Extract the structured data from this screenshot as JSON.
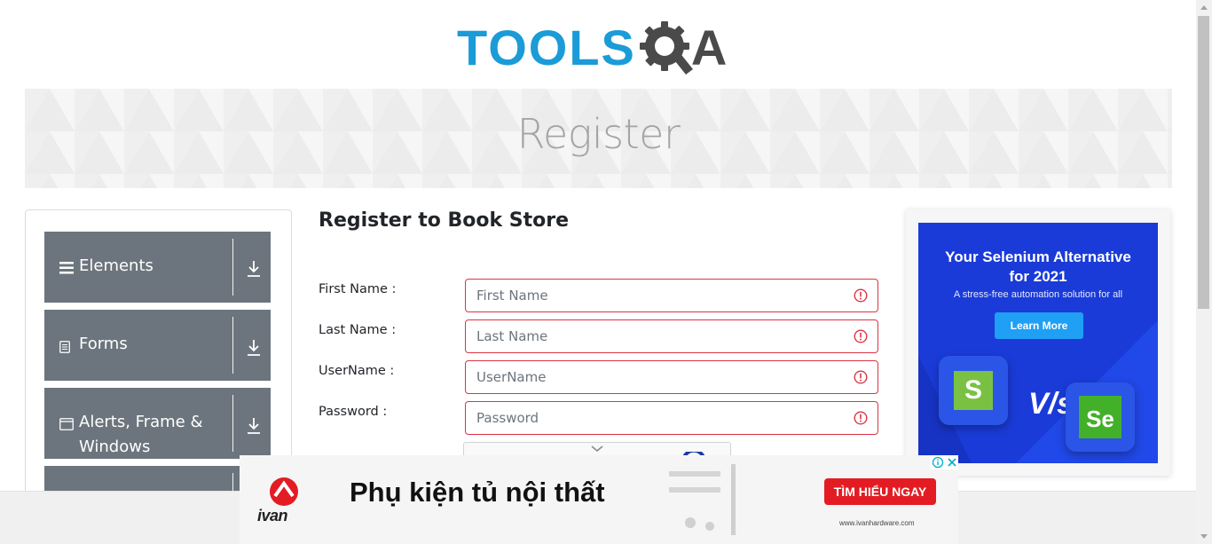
{
  "header": {
    "logo_left": "TOOLS",
    "logo_right": "A",
    "colors": {
      "logo_blue": "#1b9bd7",
      "logo_gray": "#4a4a4a"
    }
  },
  "banner": {
    "title": "Register"
  },
  "sidebar": {
    "groups": [
      {
        "label": "Elements",
        "icon": "hamburger-icon"
      },
      {
        "label": "Forms",
        "icon": "document-icon"
      },
      {
        "label": "Alerts, Frame &",
        "label2": "Windows",
        "icon": "window-icon"
      },
      {
        "label": "",
        "icon": ""
      }
    ],
    "colors": {
      "group_bg": "#6c757d"
    }
  },
  "form": {
    "heading": "Register to Book Store",
    "fields": [
      {
        "label": "First Name :",
        "placeholder": "First Name",
        "value": ""
      },
      {
        "label": "Last Name :",
        "placeholder": "Last Name",
        "value": ""
      },
      {
        "label": "UserName :",
        "placeholder": "UserName",
        "value": ""
      },
      {
        "label": "Password :",
        "placeholder": "Password",
        "value": ""
      }
    ],
    "colors": {
      "invalid_border": "#dc3545"
    }
  },
  "ad_right": {
    "headline_line1": "Your Selenium Alternative",
    "headline_line2": "for 2021",
    "subtext": "A stress-free automation solution for all",
    "button": "Learn More",
    "vs": "V/s",
    "badge_left": "S",
    "badge_right": "Se",
    "colors": {
      "bg": "#1a3bd8",
      "button": "#1fa0f5"
    }
  },
  "ad_bottom": {
    "brand": "ivan",
    "text": "Phụ kiện tủ nội thất",
    "cta": "TÌM HIỂU NGAY",
    "url": "www.ivanhardware.com",
    "colors": {
      "cta": "#e31c23"
    }
  }
}
